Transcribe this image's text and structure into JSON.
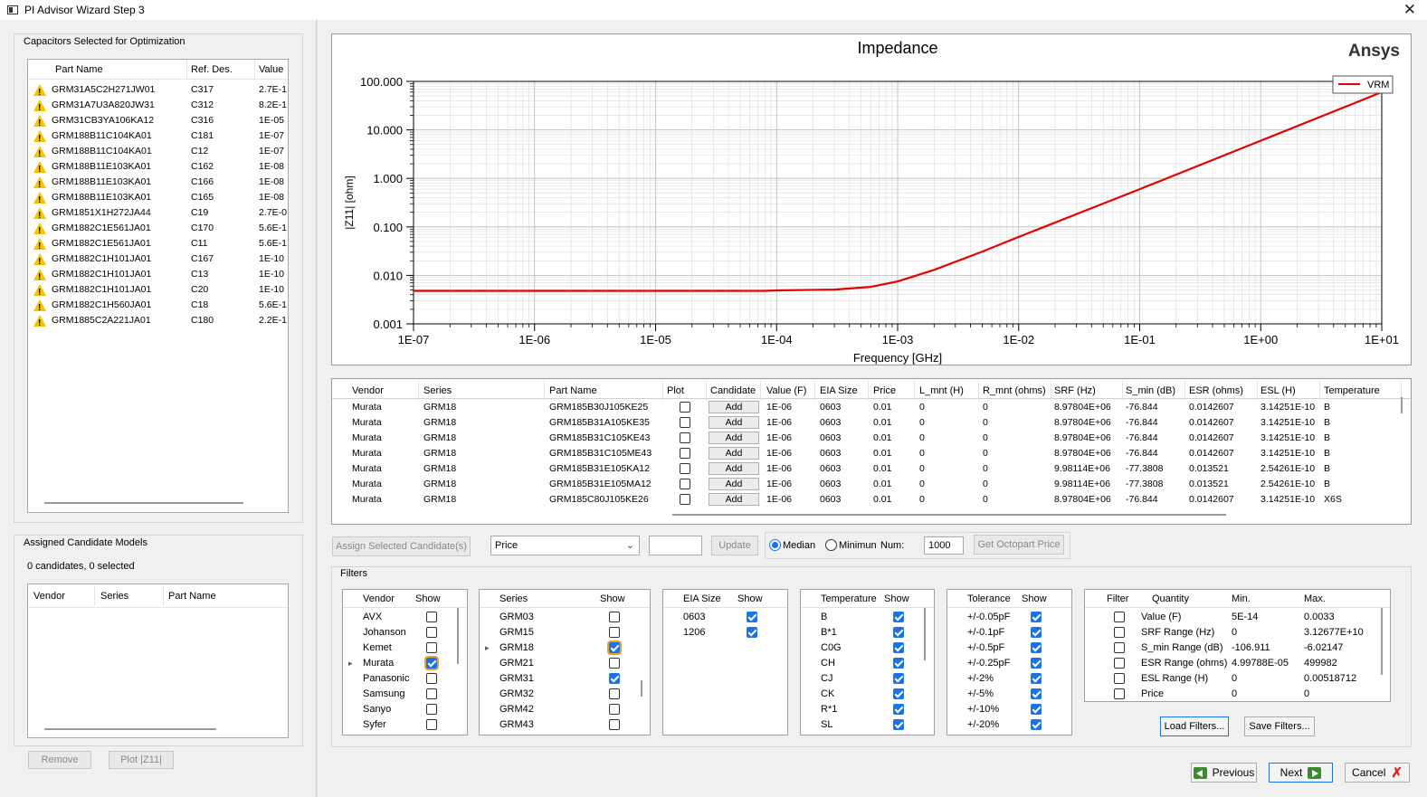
{
  "window": {
    "title": "PI Advisor Wizard Step 3",
    "close_glyph": "✕"
  },
  "left": {
    "caps_group_title": "Capacitors Selected for Optimization",
    "caps_headers": [
      "Part Name",
      "Ref. Des.",
      "Value"
    ],
    "caps_rows": [
      [
        "GRM31A5C2H271JW01",
        "C317",
        "2.7E-1"
      ],
      [
        "GRM31A7U3A820JW31",
        "C312",
        "8.2E-1"
      ],
      [
        "GRM31CB3YA106KA12",
        "C316",
        "1E-05"
      ],
      [
        "GRM188B11C104KA01",
        "C181",
        "1E-07"
      ],
      [
        "GRM188B11C104KA01",
        "C12",
        "1E-07"
      ],
      [
        "GRM188B11E103KA01",
        "C162",
        "1E-08"
      ],
      [
        "GRM188B11E103KA01",
        "C166",
        "1E-08"
      ],
      [
        "GRM188B11E103KA01",
        "C165",
        "1E-08"
      ],
      [
        "GRM1851X1H272JA44",
        "C19",
        "2.7E-0"
      ],
      [
        "GRM1882C1E561JA01",
        "C170",
        "5.6E-1"
      ],
      [
        "GRM1882C1E561JA01",
        "C11",
        "5.6E-1"
      ],
      [
        "GRM1882C1H101JA01",
        "C167",
        "1E-10"
      ],
      [
        "GRM1882C1H101JA01",
        "C13",
        "1E-10"
      ],
      [
        "GRM1882C1H101JA01",
        "C20",
        "1E-10"
      ],
      [
        "GRM1882C1H560JA01",
        "C18",
        "5.6E-1"
      ],
      [
        "GRM1885C2A221JA01",
        "C180",
        "2.2E-1"
      ]
    ],
    "assigned_group_title": "Assigned Candidate Models",
    "assigned_count": "0 candidates, 0 selected",
    "assigned_headers": [
      "Vendor",
      "Series",
      "Part Name"
    ],
    "remove_label": "Remove",
    "plot_label": "Plot |Z11|"
  },
  "chart": {
    "brand": "Ansys",
    "legend_series": "VRM"
  },
  "chart_data": {
    "type": "line",
    "title": "Impedance",
    "xlabel": "Frequency [GHz]",
    "ylabel": "|Z11| [ohm]",
    "x_scale": "log",
    "y_scale": "log",
    "xlim": [
      1e-07,
      10
    ],
    "ylim": [
      0.001,
      100
    ],
    "x_ticks": [
      "1E-07",
      "1E-06",
      "1E-05",
      "1E-04",
      "1E-03",
      "1E-02",
      "1E-01",
      "1E+00",
      "1E+01"
    ],
    "y_ticks": [
      "0.001",
      "0.010",
      "0.100",
      "1.000",
      "10.000",
      "100.000"
    ],
    "grid": true,
    "legend_position": "top-right",
    "series": [
      {
        "name": "VRM",
        "color": "#e60000",
        "x": [
          1e-07,
          1e-06,
          1e-05,
          8e-05,
          0.0001,
          0.0003,
          0.0006,
          0.001,
          0.002,
          0.005,
          0.01,
          0.1,
          1,
          10
        ],
        "y": [
          0.0048,
          0.0048,
          0.0048,
          0.0048,
          0.0049,
          0.0051,
          0.0058,
          0.0075,
          0.013,
          0.031,
          0.062,
          0.6,
          6.0,
          60
        ]
      }
    ]
  },
  "candidates": {
    "headers": [
      "Vendor",
      "Series",
      "Part Name",
      "Plot",
      "Candidate",
      "Value (F)",
      "EIA Size",
      "Price",
      "L_mnt (H)",
      "R_mnt (ohms)",
      "SRF (Hz)",
      "S_min (dB)",
      "ESR (ohms)",
      "ESL (H)",
      "Temperature"
    ],
    "add_label": "Add",
    "rows": [
      [
        "Murata",
        "GRM18",
        "GRM185B30J105KE25",
        "1E-06",
        "0603",
        "0.01",
        "0",
        "0",
        "8.97804E+06",
        "-76.844",
        "0.0142607",
        "3.14251E-10",
        "B"
      ],
      [
        "Murata",
        "GRM18",
        "GRM185B31A105KE35",
        "1E-06",
        "0603",
        "0.01",
        "0",
        "0",
        "8.97804E+06",
        "-76.844",
        "0.0142607",
        "3.14251E-10",
        "B"
      ],
      [
        "Murata",
        "GRM18",
        "GRM185B31C105KE43",
        "1E-06",
        "0603",
        "0.01",
        "0",
        "0",
        "8.97804E+06",
        "-76.844",
        "0.0142607",
        "3.14251E-10",
        "B"
      ],
      [
        "Murata",
        "GRM18",
        "GRM185B31C105ME43",
        "1E-06",
        "0603",
        "0.01",
        "0",
        "0",
        "8.97804E+06",
        "-76.844",
        "0.0142607",
        "3.14251E-10",
        "B"
      ],
      [
        "Murata",
        "GRM18",
        "GRM185B31E105KA12",
        "1E-06",
        "0603",
        "0.01",
        "0",
        "0",
        "9.98114E+06",
        "-77.3808",
        "0.013521",
        "2.54261E-10",
        "B"
      ],
      [
        "Murata",
        "GRM18",
        "GRM185B31E105MA12",
        "1E-06",
        "0603",
        "0.01",
        "0",
        "0",
        "9.98114E+06",
        "-77.3808",
        "0.013521",
        "2.54261E-10",
        "B"
      ],
      [
        "Murata",
        "GRM18",
        "GRM185C80J105KE26",
        "1E-06",
        "0603",
        "0.01",
        "0",
        "0",
        "8.97804E+06",
        "-76.844",
        "0.0142607",
        "3.14251E-10",
        "X6S"
      ]
    ]
  },
  "toolbar": {
    "assign_label": "Assign Selected Candidate(s)",
    "sort_value": "Price",
    "update_label": "Update",
    "median_label": "Median",
    "minimum_label": "Minimun",
    "num_label": "Num:",
    "num_value": "1000",
    "octopart_label": "Get Octopart Price"
  },
  "filters": {
    "title": "Filters",
    "vendor": {
      "h1": "Vendor",
      "h2": "Show",
      "items": [
        [
          "AVX",
          false
        ],
        [
          "Johanson",
          false
        ],
        [
          "Kemet",
          false
        ],
        [
          "Murata",
          true
        ],
        [
          "Panasonic",
          false
        ],
        [
          "Samsung",
          false
        ],
        [
          "Sanyo",
          false
        ],
        [
          "Syfer",
          false
        ]
      ]
    },
    "series": {
      "h1": "Series",
      "h2": "Show",
      "items": [
        [
          "GRM03",
          false
        ],
        [
          "GRM15",
          false
        ],
        [
          "GRM18",
          true
        ],
        [
          "GRM21",
          false
        ],
        [
          "GRM31",
          true
        ],
        [
          "GRM32",
          false
        ],
        [
          "GRM42",
          false
        ],
        [
          "GRM43",
          false
        ]
      ]
    },
    "eia": {
      "h1": "EIA Size",
      "h2": "Show",
      "items": [
        [
          "0603",
          true
        ],
        [
          "1206",
          true
        ]
      ]
    },
    "temperature": {
      "h1": "Temperature",
      "h2": "Show",
      "items": [
        [
          "B",
          true
        ],
        [
          "B*1",
          true
        ],
        [
          "C0G",
          true
        ],
        [
          "CH",
          true
        ],
        [
          "CJ",
          true
        ],
        [
          "CK",
          true
        ],
        [
          "R*1",
          true
        ],
        [
          "SL",
          true
        ]
      ]
    },
    "tolerance": {
      "h1": "Tolerance",
      "h2": "Show",
      "items": [
        [
          "+/-0.05pF",
          true
        ],
        [
          "+/-0.1pF",
          true
        ],
        [
          "+/-0.5pF",
          true
        ],
        [
          "+/-0.25pF",
          true
        ],
        [
          "+/-2%",
          true
        ],
        [
          "+/-5%",
          true
        ],
        [
          "+/-10%",
          true
        ],
        [
          "+/-20%",
          true
        ]
      ]
    },
    "quantity": {
      "headers": [
        "Filter",
        "Quantity",
        "Min.",
        "Max."
      ],
      "rows": [
        [
          "Value (F)",
          "5E-14",
          "0.0033"
        ],
        [
          "SRF Range (Hz)",
          "0",
          "3.12677E+10"
        ],
        [
          "S_min Range (dB)",
          "-106.911",
          "-6.02147"
        ],
        [
          "ESR Range (ohms)",
          "4.99788E-05",
          "499982"
        ],
        [
          "ESL Range (H)",
          "0",
          "0.00518712"
        ],
        [
          "Price",
          "0",
          "0"
        ]
      ]
    },
    "load_label": "Load Filters...",
    "save_label": "Save Filters..."
  },
  "nav": {
    "previous": "Previous",
    "next": "Next",
    "cancel": "Cancel"
  }
}
